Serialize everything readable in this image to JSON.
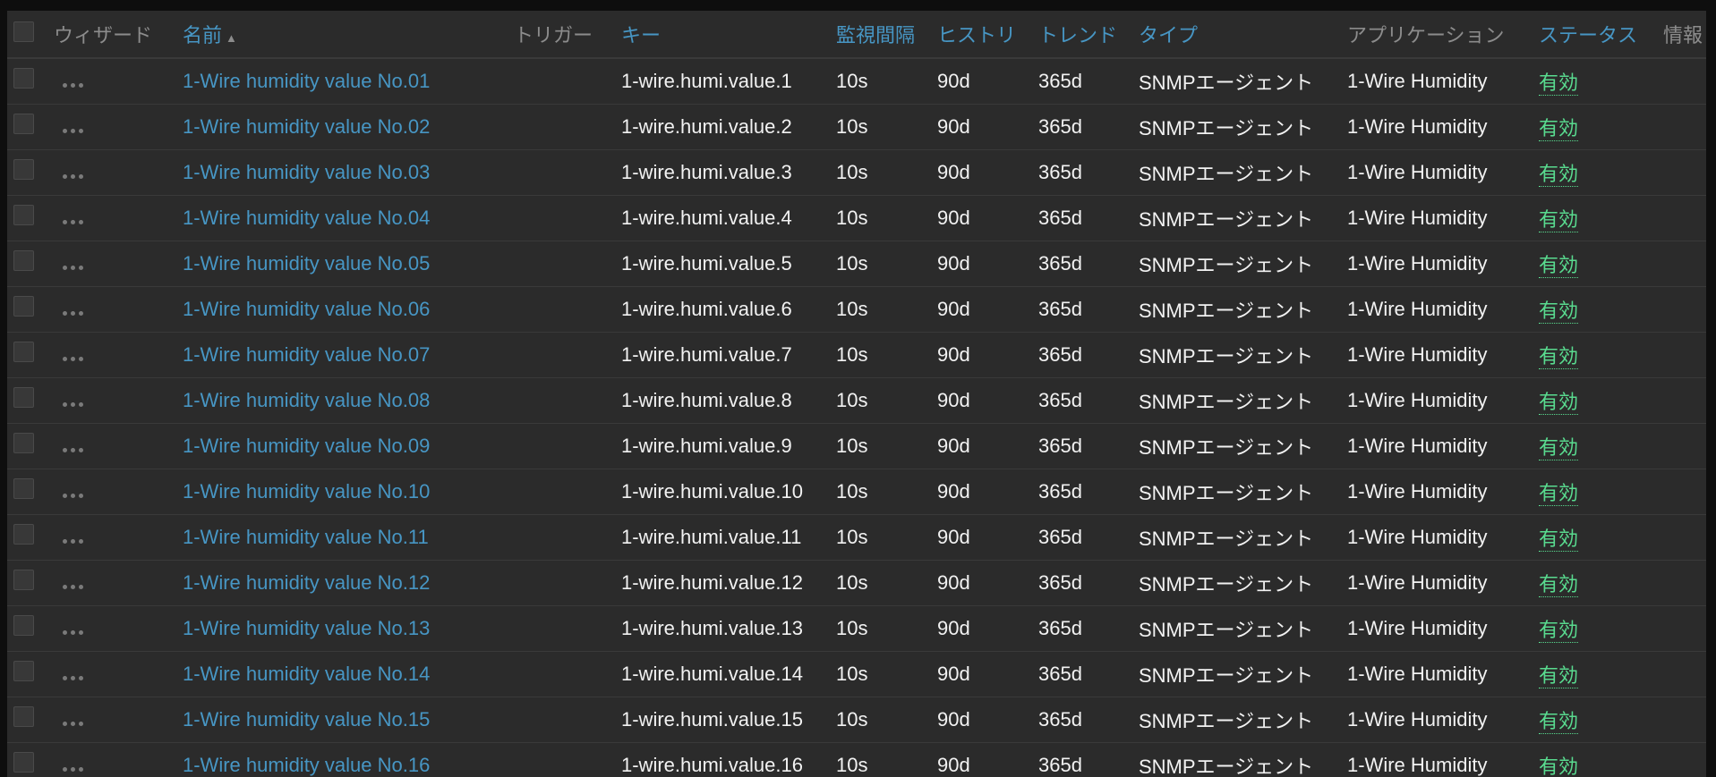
{
  "headers": {
    "wizard": "ウィザード",
    "name": "名前",
    "name_sort": "▲",
    "triggers": "トリガー",
    "key": "キー",
    "interval": "監視間隔",
    "history": "ヒストリ",
    "trends": "トレンド",
    "type": "タイプ",
    "applications": "アプリケーション",
    "status": "ステータス",
    "info": "情報"
  },
  "rows": [
    {
      "name": "1-Wire humidity value No.01",
      "triggers": "",
      "key": "1-wire.humi.value.1",
      "interval": "10s",
      "history": "90d",
      "trends": "365d",
      "type": "SNMPエージェント",
      "application": "1-Wire Humidity",
      "status": "有効"
    },
    {
      "name": "1-Wire humidity value No.02",
      "triggers": "",
      "key": "1-wire.humi.value.2",
      "interval": "10s",
      "history": "90d",
      "trends": "365d",
      "type": "SNMPエージェント",
      "application": "1-Wire Humidity",
      "status": "有効"
    },
    {
      "name": "1-Wire humidity value No.03",
      "triggers": "",
      "key": "1-wire.humi.value.3",
      "interval": "10s",
      "history": "90d",
      "trends": "365d",
      "type": "SNMPエージェント",
      "application": "1-Wire Humidity",
      "status": "有効"
    },
    {
      "name": "1-Wire humidity value No.04",
      "triggers": "",
      "key": "1-wire.humi.value.4",
      "interval": "10s",
      "history": "90d",
      "trends": "365d",
      "type": "SNMPエージェント",
      "application": "1-Wire Humidity",
      "status": "有効"
    },
    {
      "name": "1-Wire humidity value No.05",
      "triggers": "",
      "key": "1-wire.humi.value.5",
      "interval": "10s",
      "history": "90d",
      "trends": "365d",
      "type": "SNMPエージェント",
      "application": "1-Wire Humidity",
      "status": "有効"
    },
    {
      "name": "1-Wire humidity value No.06",
      "triggers": "",
      "key": "1-wire.humi.value.6",
      "interval": "10s",
      "history": "90d",
      "trends": "365d",
      "type": "SNMPエージェント",
      "application": "1-Wire Humidity",
      "status": "有効"
    },
    {
      "name": "1-Wire humidity value No.07",
      "triggers": "",
      "key": "1-wire.humi.value.7",
      "interval": "10s",
      "history": "90d",
      "trends": "365d",
      "type": "SNMPエージェント",
      "application": "1-Wire Humidity",
      "status": "有効"
    },
    {
      "name": "1-Wire humidity value No.08",
      "triggers": "",
      "key": "1-wire.humi.value.8",
      "interval": "10s",
      "history": "90d",
      "trends": "365d",
      "type": "SNMPエージェント",
      "application": "1-Wire Humidity",
      "status": "有効"
    },
    {
      "name": "1-Wire humidity value No.09",
      "triggers": "",
      "key": "1-wire.humi.value.9",
      "interval": "10s",
      "history": "90d",
      "trends": "365d",
      "type": "SNMPエージェント",
      "application": "1-Wire Humidity",
      "status": "有効"
    },
    {
      "name": "1-Wire humidity value No.10",
      "triggers": "",
      "key": "1-wire.humi.value.10",
      "interval": "10s",
      "history": "90d",
      "trends": "365d",
      "type": "SNMPエージェント",
      "application": "1-Wire Humidity",
      "status": "有効"
    },
    {
      "name": "1-Wire humidity value No.11",
      "triggers": "",
      "key": "1-wire.humi.value.11",
      "interval": "10s",
      "history": "90d",
      "trends": "365d",
      "type": "SNMPエージェント",
      "application": "1-Wire Humidity",
      "status": "有効"
    },
    {
      "name": "1-Wire humidity value No.12",
      "triggers": "",
      "key": "1-wire.humi.value.12",
      "interval": "10s",
      "history": "90d",
      "trends": "365d",
      "type": "SNMPエージェント",
      "application": "1-Wire Humidity",
      "status": "有効"
    },
    {
      "name": "1-Wire humidity value No.13",
      "triggers": "",
      "key": "1-wire.humi.value.13",
      "interval": "10s",
      "history": "90d",
      "trends": "365d",
      "type": "SNMPエージェント",
      "application": "1-Wire Humidity",
      "status": "有効"
    },
    {
      "name": "1-Wire humidity value No.14",
      "triggers": "",
      "key": "1-wire.humi.value.14",
      "interval": "10s",
      "history": "90d",
      "trends": "365d",
      "type": "SNMPエージェント",
      "application": "1-Wire Humidity",
      "status": "有効"
    },
    {
      "name": "1-Wire humidity value No.15",
      "triggers": "",
      "key": "1-wire.humi.value.15",
      "interval": "10s",
      "history": "90d",
      "trends": "365d",
      "type": "SNMPエージェント",
      "application": "1-Wire Humidity",
      "status": "有効"
    },
    {
      "name": "1-Wire humidity value No.16",
      "triggers": "",
      "key": "1-wire.humi.value.16",
      "interval": "10s",
      "history": "90d",
      "trends": "365d",
      "type": "SNMPエージェント",
      "application": "1-Wire Humidity",
      "status": "有効"
    }
  ],
  "icons": {
    "select_all": "checkbox-icon",
    "row_select": "checkbox-icon",
    "wizard": "more-dots-icon"
  },
  "colors": {
    "link": "#4796c4",
    "status_enabled": "#59db8f",
    "header_static": "#8c8c8c",
    "text": "#f2f2f2",
    "table_bg": "#2b2b2b",
    "page_bg": "#0e0e0e"
  }
}
